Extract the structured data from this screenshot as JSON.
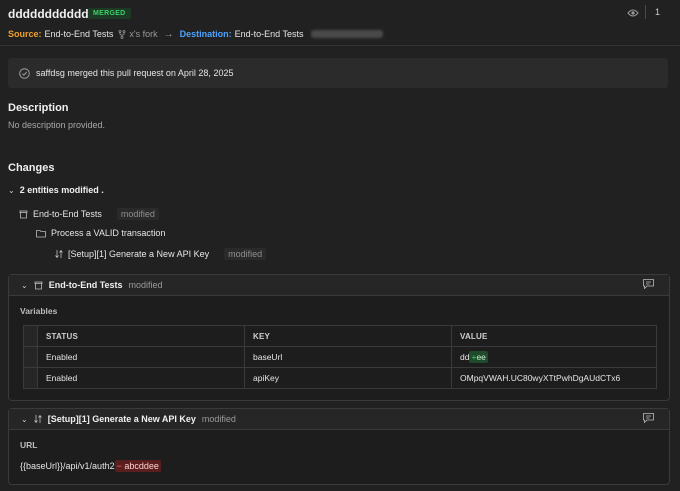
{
  "header": {
    "title": "dddddddddddd",
    "status_badge": "MERGED",
    "watchers_count": "1"
  },
  "branches": {
    "source_label": "Source:",
    "source_name": "End-to-End Tests",
    "fork_name": "x's fork",
    "arrow": "→",
    "destination_label": "Destination:",
    "destination_name": "End-to-End Tests"
  },
  "merge_banner": {
    "text": "saffdsg merged this pull request on April 28, 2025"
  },
  "description": {
    "heading": "Description",
    "text": "No description provided."
  },
  "changes": {
    "heading": "Changes",
    "summary": "2 entities modified .",
    "tree": [
      {
        "name": "End-to-End Tests",
        "tag": "modified",
        "icon": "collection-icon"
      },
      {
        "name": "Process a VALID transaction",
        "tag": "",
        "icon": "folder-icon"
      },
      {
        "name": "[Setup][1] Generate a New API Key",
        "tag": "modified",
        "icon": "request-icon"
      }
    ]
  },
  "card1": {
    "title": "End-to-End Tests",
    "tag": "modified",
    "section_label": "Variables",
    "columns": [
      "STATUS",
      "KEY",
      "VALUE"
    ],
    "rows": [
      {
        "status": "Enabled",
        "key": "baseUrl",
        "value_old": "dd",
        "value_added": "ee"
      },
      {
        "status": "Enabled",
        "key": "apiKey",
        "value": "OMpqVWAH.UC80wyXTtPwhDgAUdCTx6"
      }
    ],
    "diff_plus": "+"
  },
  "card2": {
    "title": "[Setup][1] Generate a New API Key",
    "tag": "modified",
    "section_label": "URL",
    "url_base": "{{baseUrl}}/api/v1/auth2",
    "diff_minus": "−",
    "url_removed": "abcddee"
  },
  "colors": {
    "background": "#212121",
    "merged_green": "#3fd06b",
    "source_orange": "#f0a030",
    "destination_blue": "#4ea3ff",
    "diff_added_bg": "#1f4a2b",
    "diff_removed_bg": "#5a1e1e"
  }
}
